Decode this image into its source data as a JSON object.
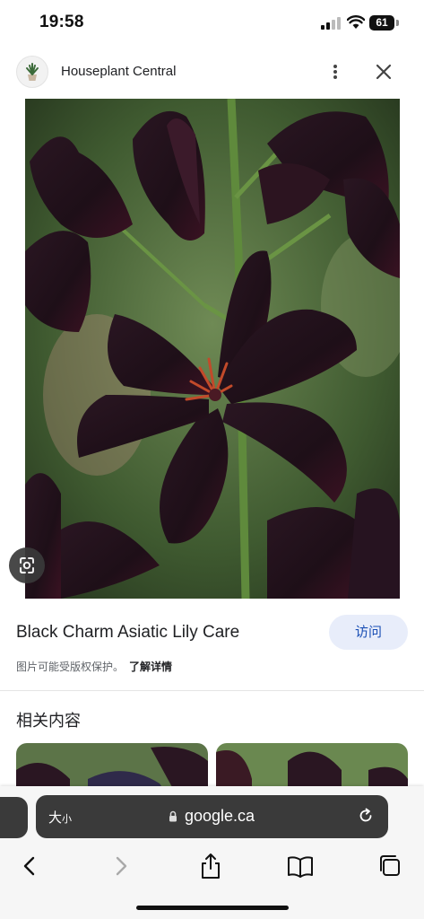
{
  "status_bar": {
    "time": "19:58",
    "battery": "61"
  },
  "site_header": {
    "name": "Houseplant Central",
    "favicon": "potted-plant-icon"
  },
  "image_panel": {
    "title": "Black Charm Asiatic Lily Care",
    "visit_label": "访问",
    "copyright_notice": "图片可能受版权保护。",
    "learn_more": "了解详情"
  },
  "related": {
    "title": "相关内容"
  },
  "browser": {
    "text_size_label": "大",
    "text_size_small": "小",
    "url": "google.ca"
  },
  "colors": {
    "accent": "#1a4fb5",
    "visit_bg": "#e8edfa"
  }
}
